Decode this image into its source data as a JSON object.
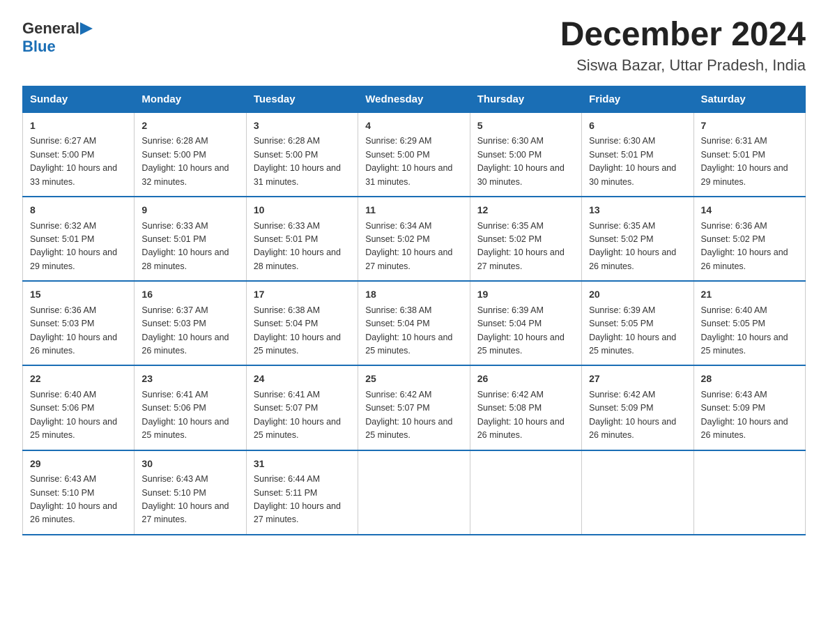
{
  "header": {
    "logo_general": "General",
    "logo_blue": "Blue",
    "title": "December 2024",
    "subtitle": "Siswa Bazar, Uttar Pradesh, India"
  },
  "calendar": {
    "days": [
      "Sunday",
      "Monday",
      "Tuesday",
      "Wednesday",
      "Thursday",
      "Friday",
      "Saturday"
    ],
    "weeks": [
      [
        {
          "date": "1",
          "sunrise": "6:27 AM",
          "sunset": "5:00 PM",
          "daylight": "10 hours and 33 minutes."
        },
        {
          "date": "2",
          "sunrise": "6:28 AM",
          "sunset": "5:00 PM",
          "daylight": "10 hours and 32 minutes."
        },
        {
          "date": "3",
          "sunrise": "6:28 AM",
          "sunset": "5:00 PM",
          "daylight": "10 hours and 31 minutes."
        },
        {
          "date": "4",
          "sunrise": "6:29 AM",
          "sunset": "5:00 PM",
          "daylight": "10 hours and 31 minutes."
        },
        {
          "date": "5",
          "sunrise": "6:30 AM",
          "sunset": "5:00 PM",
          "daylight": "10 hours and 30 minutes."
        },
        {
          "date": "6",
          "sunrise": "6:30 AM",
          "sunset": "5:01 PM",
          "daylight": "10 hours and 30 minutes."
        },
        {
          "date": "7",
          "sunrise": "6:31 AM",
          "sunset": "5:01 PM",
          "daylight": "10 hours and 29 minutes."
        }
      ],
      [
        {
          "date": "8",
          "sunrise": "6:32 AM",
          "sunset": "5:01 PM",
          "daylight": "10 hours and 29 minutes."
        },
        {
          "date": "9",
          "sunrise": "6:33 AM",
          "sunset": "5:01 PM",
          "daylight": "10 hours and 28 minutes."
        },
        {
          "date": "10",
          "sunrise": "6:33 AM",
          "sunset": "5:01 PM",
          "daylight": "10 hours and 28 minutes."
        },
        {
          "date": "11",
          "sunrise": "6:34 AM",
          "sunset": "5:02 PM",
          "daylight": "10 hours and 27 minutes."
        },
        {
          "date": "12",
          "sunrise": "6:35 AM",
          "sunset": "5:02 PM",
          "daylight": "10 hours and 27 minutes."
        },
        {
          "date": "13",
          "sunrise": "6:35 AM",
          "sunset": "5:02 PM",
          "daylight": "10 hours and 26 minutes."
        },
        {
          "date": "14",
          "sunrise": "6:36 AM",
          "sunset": "5:02 PM",
          "daylight": "10 hours and 26 minutes."
        }
      ],
      [
        {
          "date": "15",
          "sunrise": "6:36 AM",
          "sunset": "5:03 PM",
          "daylight": "10 hours and 26 minutes."
        },
        {
          "date": "16",
          "sunrise": "6:37 AM",
          "sunset": "5:03 PM",
          "daylight": "10 hours and 26 minutes."
        },
        {
          "date": "17",
          "sunrise": "6:38 AM",
          "sunset": "5:04 PM",
          "daylight": "10 hours and 25 minutes."
        },
        {
          "date": "18",
          "sunrise": "6:38 AM",
          "sunset": "5:04 PM",
          "daylight": "10 hours and 25 minutes."
        },
        {
          "date": "19",
          "sunrise": "6:39 AM",
          "sunset": "5:04 PM",
          "daylight": "10 hours and 25 minutes."
        },
        {
          "date": "20",
          "sunrise": "6:39 AM",
          "sunset": "5:05 PM",
          "daylight": "10 hours and 25 minutes."
        },
        {
          "date": "21",
          "sunrise": "6:40 AM",
          "sunset": "5:05 PM",
          "daylight": "10 hours and 25 minutes."
        }
      ],
      [
        {
          "date": "22",
          "sunrise": "6:40 AM",
          "sunset": "5:06 PM",
          "daylight": "10 hours and 25 minutes."
        },
        {
          "date": "23",
          "sunrise": "6:41 AM",
          "sunset": "5:06 PM",
          "daylight": "10 hours and 25 minutes."
        },
        {
          "date": "24",
          "sunrise": "6:41 AM",
          "sunset": "5:07 PM",
          "daylight": "10 hours and 25 minutes."
        },
        {
          "date": "25",
          "sunrise": "6:42 AM",
          "sunset": "5:07 PM",
          "daylight": "10 hours and 25 minutes."
        },
        {
          "date": "26",
          "sunrise": "6:42 AM",
          "sunset": "5:08 PM",
          "daylight": "10 hours and 26 minutes."
        },
        {
          "date": "27",
          "sunrise": "6:42 AM",
          "sunset": "5:09 PM",
          "daylight": "10 hours and 26 minutes."
        },
        {
          "date": "28",
          "sunrise": "6:43 AM",
          "sunset": "5:09 PM",
          "daylight": "10 hours and 26 minutes."
        }
      ],
      [
        {
          "date": "29",
          "sunrise": "6:43 AM",
          "sunset": "5:10 PM",
          "daylight": "10 hours and 26 minutes."
        },
        {
          "date": "30",
          "sunrise": "6:43 AM",
          "sunset": "5:10 PM",
          "daylight": "10 hours and 27 minutes."
        },
        {
          "date": "31",
          "sunrise": "6:44 AM",
          "sunset": "5:11 PM",
          "daylight": "10 hours and 27 minutes."
        },
        null,
        null,
        null,
        null
      ]
    ]
  },
  "labels": {
    "sunrise": "Sunrise:",
    "sunset": "Sunset:",
    "daylight": "Daylight:"
  }
}
